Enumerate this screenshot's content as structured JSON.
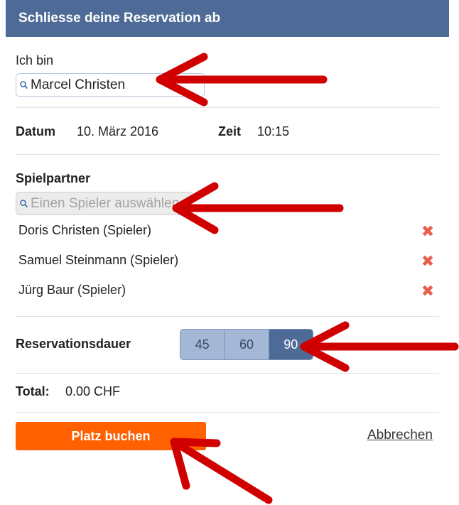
{
  "header": {
    "title": "Schliesse deine Reservation ab"
  },
  "identity": {
    "label": "Ich bin",
    "value": "Marcel Christen"
  },
  "booking": {
    "date_label": "Datum",
    "date_value": "10. März 2016",
    "time_label": "Zeit",
    "time_value": "10:15"
  },
  "partners": {
    "heading": "Spielpartner",
    "search_placeholder": "Einen Spieler auswählen",
    "items": [
      {
        "name": "Doris Christen (Spieler)",
        "remove_icon": "close-icon"
      },
      {
        "name": "Samuel Steinmann (Spieler)",
        "remove_icon": "close-icon"
      },
      {
        "name": "Jürg Baur (Spieler)",
        "remove_icon": "close-icon"
      }
    ]
  },
  "duration": {
    "label": "Reservationsdauer",
    "options": [
      "45",
      "60",
      "90"
    ],
    "selected": "90"
  },
  "total": {
    "label": "Total:",
    "value": "0.00 CHF"
  },
  "actions": {
    "book_label": "Platz buchen",
    "cancel_label": "Abbrechen"
  },
  "colors": {
    "header": "#4e6a96",
    "book_button": "#ff6000",
    "remove_icon": "#e8604c",
    "annotation_arrow": "#d00000"
  }
}
